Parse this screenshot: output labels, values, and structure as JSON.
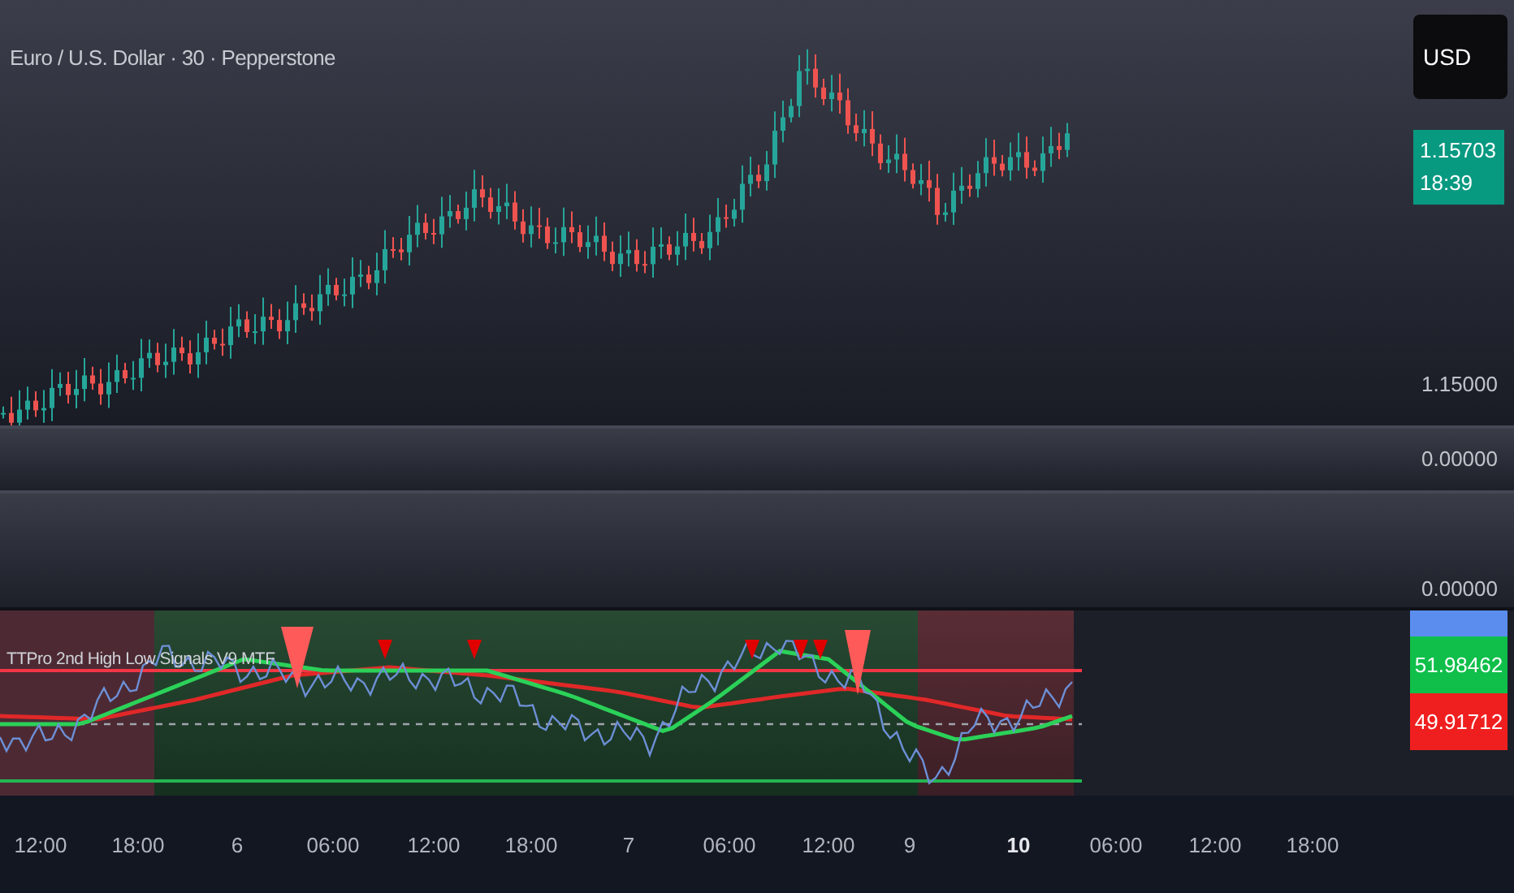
{
  "chart_title": "Euro / U.S. Dollar · 30 · Pepperstone",
  "currency_button": "USD",
  "last_price": {
    "price": "1.15703",
    "countdown": "18:39"
  },
  "main_axis_label": "1.15000",
  "empty_panes": [
    {
      "axis_label": "0.00000"
    },
    {
      "axis_label": "0.00000"
    }
  ],
  "indicator": {
    "name": "TTPro 2nd High Low Signals V9 MTF",
    "badges": [
      {
        "value": "51.98462",
        "color": "#0fbf4a"
      },
      {
        "value": "49.91712",
        "color": "#f01f1f"
      }
    ]
  },
  "time_axis": [
    {
      "label": "12:00",
      "bold": false
    },
    {
      "label": "18:00",
      "bold": false
    },
    {
      "label": "6",
      "bold": false
    },
    {
      "label": "06:00",
      "bold": false
    },
    {
      "label": "12:00",
      "bold": false
    },
    {
      "label": "18:00",
      "bold": false
    },
    {
      "label": "7",
      "bold": false
    },
    {
      "label": "06:00",
      "bold": false
    },
    {
      "label": "12:00",
      "bold": false
    },
    {
      "label": "9",
      "bold": false
    },
    {
      "label": "10",
      "bold": true
    },
    {
      "label": "06:00",
      "bold": false
    },
    {
      "label": "12:00",
      "bold": false
    },
    {
      "label": "18:00",
      "bold": false
    }
  ]
}
